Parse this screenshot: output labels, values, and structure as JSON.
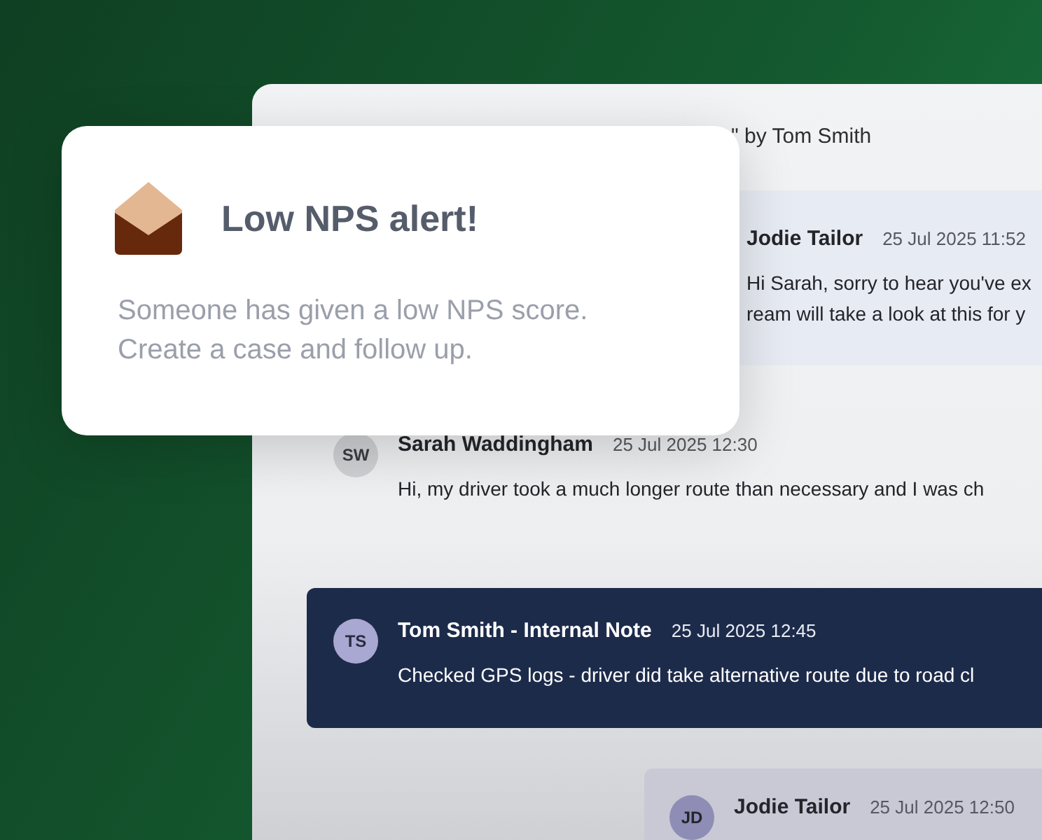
{
  "alert": {
    "title": "Low NPS alert!",
    "message": "Someone has given a low NPS score. Create a case and follow up."
  },
  "thread": {
    "header": "\" by Tom Smith",
    "messages": [
      {
        "kind": "reply",
        "author": "Jodie Tailor",
        "time": "25 Jul 2025 11:52",
        "lines": [
          "Hi Sarah, sorry to hear you've ex",
          "ream will take a look at this for y"
        ]
      },
      {
        "kind": "customer",
        "initials": "SW",
        "author": "Sarah Waddingham",
        "time": "25 Jul 2025 12:30",
        "lines": [
          "Hi, my driver took a much longer route than necessary and I was ch"
        ]
      },
      {
        "kind": "note",
        "initials": "TS",
        "author": "Tom Smith - **Internal Note**",
        "time": "25 Jul 2025 12:45",
        "lines": [
          "Checked GPS logs - driver did take alternative route due to road cl"
        ]
      },
      {
        "kind": "reply",
        "initials": "JD",
        "author": "Jodie Tailor",
        "time": "25 Jul 2025 12:50"
      }
    ]
  }
}
